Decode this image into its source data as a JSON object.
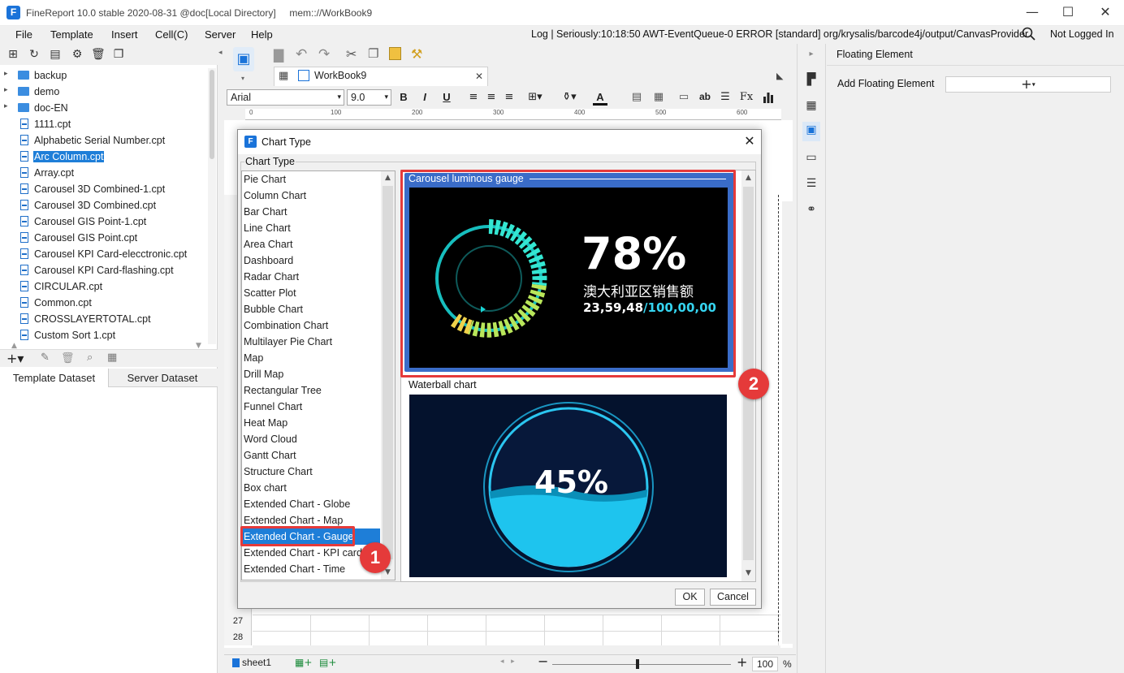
{
  "window": {
    "title": "FineReport 10.0 stable 2020-08-31 @doc[Local Directory]     mem:://WorkBook9",
    "minimize": "—",
    "maximize": "☐",
    "close": "✕"
  },
  "menu": {
    "items": [
      "File",
      "Template",
      "Insert",
      "Cell(C)",
      "Server",
      "Help"
    ],
    "log": "Log | Seriously:10:18:50 AWT-EventQueue-0 ERROR [standard] org/krysalis/barcode4j/output/CanvasProvider",
    "login_status": "Not Logged In"
  },
  "tree": {
    "items": [
      {
        "label": "backup",
        "type": "folder"
      },
      {
        "label": "demo",
        "type": "folder"
      },
      {
        "label": "doc-EN",
        "type": "folder"
      },
      {
        "label": "1111.cpt",
        "type": "file"
      },
      {
        "label": "Alphabetic Serial Number.cpt",
        "type": "file"
      },
      {
        "label": "Arc Column.cpt",
        "type": "file",
        "selected": true
      },
      {
        "label": "Array.cpt",
        "type": "file"
      },
      {
        "label": "Carousel 3D Combined-1.cpt",
        "type": "file"
      },
      {
        "label": "Carousel 3D Combined.cpt",
        "type": "file"
      },
      {
        "label": "Carousel GIS Point-1.cpt",
        "type": "file"
      },
      {
        "label": "Carousel GIS Point.cpt",
        "type": "file"
      },
      {
        "label": "Carousel KPI Card-elecctronic.cpt",
        "type": "file"
      },
      {
        "label": "Carousel KPI Card-flashing.cpt",
        "type": "file"
      },
      {
        "label": "CIRCULAR.cpt",
        "type": "file"
      },
      {
        "label": "Common.cpt",
        "type": "file"
      },
      {
        "label": "CROSSLAYERTOTAL.cpt",
        "type": "file"
      },
      {
        "label": "Custom Sort 1.cpt",
        "type": "file"
      }
    ]
  },
  "dataset_tabs": [
    "Template Dataset",
    "Server Dataset"
  ],
  "editor": {
    "tab_label": "WorkBook9",
    "font_name": "Arial",
    "font_size": "9.0",
    "ruler_ticks": [
      "0",
      "100",
      "200",
      "300",
      "400",
      "500",
      "600"
    ],
    "row_numbers": [
      "27",
      "28"
    ],
    "sheet_tab": "sheet1",
    "zoom": "100",
    "zoom_unit": "%"
  },
  "right_panel": {
    "title": "Floating Element",
    "add_label": "Add Floating Element",
    "add_button": "+"
  },
  "dialog": {
    "title": "Chart Type",
    "group_label": "Chart Type",
    "chart_types": [
      "Pie Chart",
      "Column Chart",
      "Bar Chart",
      "Line Chart",
      "Area Chart",
      "Dashboard",
      "Radar Chart",
      "Scatter Plot",
      "Bubble Chart",
      "Combination Chart",
      "Multilayer Pie Chart",
      "Map",
      "Drill Map",
      "Rectangular Tree",
      "Funnel Chart",
      "Heat Map",
      "Word Cloud",
      "Gantt Chart",
      "Structure Chart",
      "Box chart",
      "Extended Chart - Globe",
      "Extended Chart - Map",
      "Extended Chart - Gauge",
      "Extended Chart - KPI card",
      "Extended Chart - Time"
    ],
    "selected_type": "Extended Chart - Gauge",
    "previews": [
      {
        "title": "Carousel luminous gauge",
        "percent": "78%",
        "caption": "澳大利亚区销售额",
        "value": "23,59,48",
        "total": "/100,00,00"
      },
      {
        "title": "Waterball chart",
        "percent": "45%"
      }
    ],
    "ok": "OK",
    "cancel": "Cancel"
  },
  "annotations": {
    "badge1": "1",
    "badge2": "2"
  },
  "colors": {
    "accent": "#1e7ed8",
    "highlight": "#e53a3a"
  }
}
